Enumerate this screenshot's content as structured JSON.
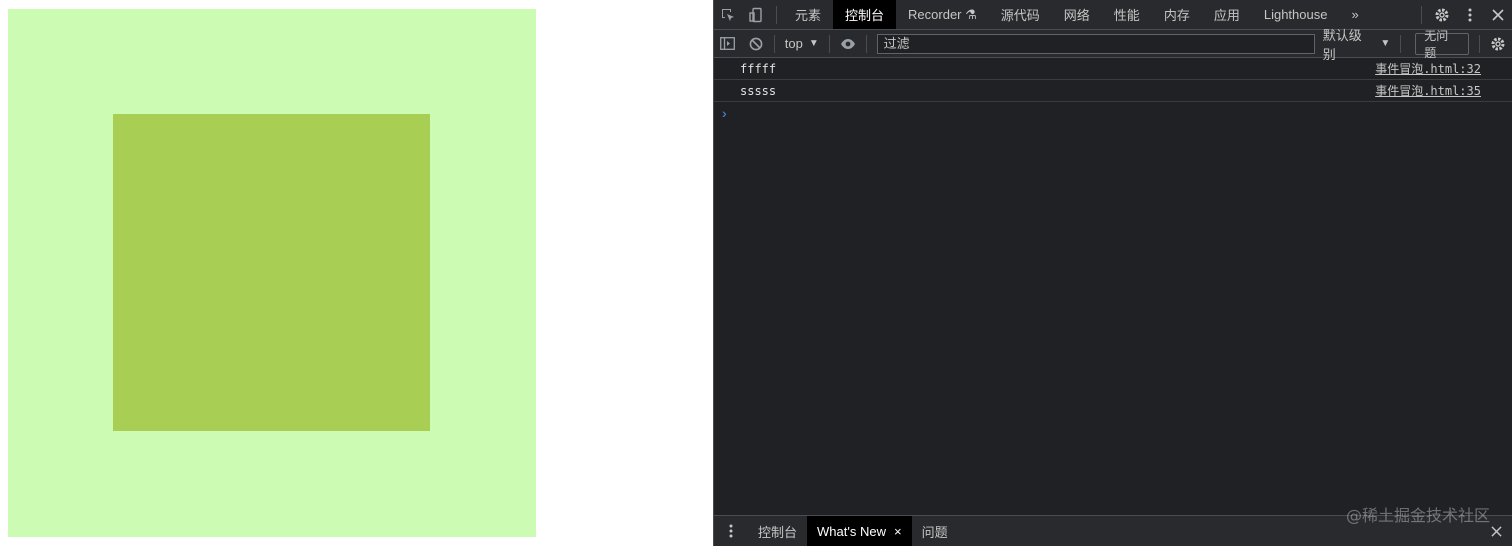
{
  "page": {
    "outer_box_color": "#ccfcb4",
    "inner_box_color": "#a8cf54"
  },
  "devtools": {
    "tabs": [
      {
        "label": "元素"
      },
      {
        "label": "控制台",
        "active": true
      },
      {
        "label": "Recorder ⚗"
      },
      {
        "label": "源代码"
      },
      {
        "label": "网络"
      },
      {
        "label": "性能"
      },
      {
        "label": "内存"
      },
      {
        "label": "应用"
      },
      {
        "label": "Lighthouse"
      }
    ],
    "more_tabs_icon": "»",
    "toolbar": {
      "context": "top",
      "filter_placeholder": "过滤",
      "levels": "默认级别",
      "issues": "无问题"
    },
    "messages": [
      {
        "text": "fffff",
        "source": "事件冒泡.html:32"
      },
      {
        "text": "sssss",
        "source": "事件冒泡.html:35"
      }
    ],
    "prompt": "›",
    "drawer": {
      "tabs": [
        {
          "label": "控制台"
        },
        {
          "label": "What's New",
          "active": true,
          "close": "×"
        },
        {
          "label": "问题"
        }
      ]
    },
    "watermark": "@稀土掘金技术社区"
  }
}
